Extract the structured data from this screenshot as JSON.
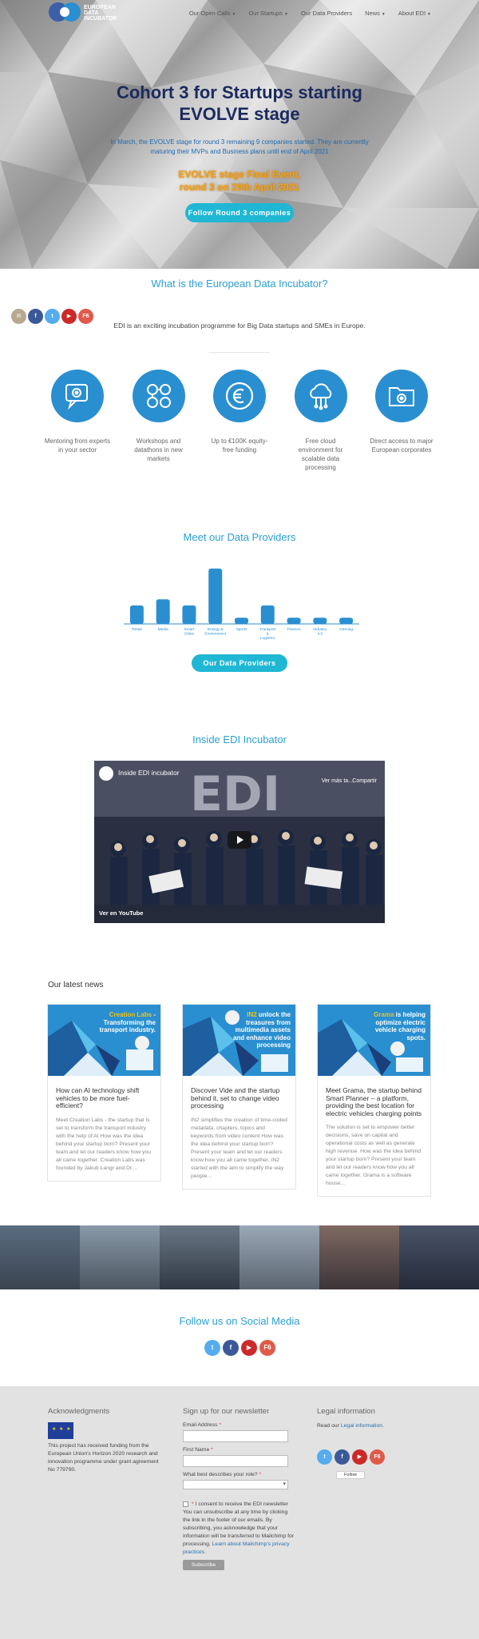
{
  "header": {
    "logo_text_line1": "EUROPEAN",
    "logo_text_line2": "DATA",
    "logo_text_line3": "INCUBATOR",
    "menu": [
      {
        "label": "Our Open Calls",
        "dropdown": true
      },
      {
        "label": "Our Startups",
        "dropdown": true
      },
      {
        "label": "Our Data Providers",
        "dropdown": false
      },
      {
        "label": "News",
        "dropdown": true
      },
      {
        "label": "About EDI",
        "dropdown": true
      }
    ]
  },
  "hero": {
    "title_line1": "Cohort 3 for Startups starting",
    "title_line2": "EVOLVE stage",
    "subtitle": "In March, the EVOLVE stage for round 3 remaining 9 companies started. They are currently maturing their MVPs and Business plans until end of April 2021",
    "event_line1": "EVOLVE stage Final Event,",
    "event_line2": "round 3 on 29th April 2021",
    "button_label": "Follow Round 3 companies"
  },
  "about": {
    "title": "What is the European Data Incubator?",
    "intro": "EDI is an exciting incubation programme for Big Data startups and SMEs in Europe.",
    "share_icons": [
      "email-icon",
      "facebook-icon",
      "twitter-icon",
      "youtube-icon",
      "f6s-icon"
    ],
    "features": [
      {
        "icon": "gear-chat-icon",
        "label": "Mentoring from experts in your sector"
      },
      {
        "icon": "team-network-icon",
        "label": "Workshops and datathons in new markets"
      },
      {
        "icon": "euro-icon",
        "label": "Up to €100K equity-free funding"
      },
      {
        "icon": "cloud-icon",
        "label": "Free cloud environment for scalable data processing"
      },
      {
        "icon": "folder-gear-icon",
        "label": "Direct access to major European corporates"
      }
    ]
  },
  "providers": {
    "title": "Meet our Data Providers",
    "button_label": "Our Data Providers"
  },
  "chart_data": {
    "type": "bar",
    "title": "",
    "xlabel": "",
    "ylabel": "",
    "categories": [
      "Retail",
      "Media",
      "Smart Cities",
      "Energy & Environment",
      "Sports",
      "Transport & Logistics",
      "Finance",
      "Industry 4.0",
      "Gaming"
    ],
    "values": [
      3,
      4,
      3,
      9,
      1,
      3,
      1,
      1,
      1
    ],
    "ylim": [
      0,
      10
    ],
    "color": "#2a8fd0"
  },
  "video": {
    "section_title": "Inside EDI Incubator",
    "title": "Inside EDI incubator",
    "watch_later": "Ver más ta...",
    "share": "Compartir",
    "watch_on": "Ver en",
    "platform": "YouTube"
  },
  "news": {
    "heading": "Our latest news",
    "cards": [
      {
        "image_text_a": "Creation Labs",
        "image_text_b": "- Transforming the transport industry.",
        "title": "How can AI technology shift vehicles to be more fuel-efficient?",
        "body": "Meet Creation Labs - the startup that is set to transform the transport industry with the help of AI How was the idea behind your startup born? Present your team and let our readers know how you all came together. Creation Labs was founded by Jakub Langr and Dr...."
      },
      {
        "image_text_a": "IN2",
        "image_text_b": "unlock the treasures from multimedia assets and enhance video processing",
        "title": "Discover Vide and the startup behind it, set to change video processing",
        "body": "IN2 simplifies the creation of time-coded metadata, chapters, topics and keywords from video content How was the idea behind your startup born? Present your team and let our readers know how you all came together. IN2 started with the aim to simplify the way people..."
      },
      {
        "image_text_a": "Grama",
        "image_text_b": "is helping optimize electric vehicle charging spots.",
        "title": "Meet Grama, the startup behind Smart Planner – a platform, providing the best location for electric vehicles charging points",
        "body": "The solution is set to empower better decisions, save on capital and operational costs as well as generate high revenue. How was the idea behind your startup born? Present your team and let our readers know how you all came together. Grama is a software house..."
      }
    ]
  },
  "social": {
    "title": "Follow us on Social Media",
    "icons": [
      "twitter-icon",
      "facebook-icon",
      "youtube-icon",
      "f6s-icon"
    ]
  },
  "footer": {
    "ack_title": "Acknowledgments",
    "ack_text": "This project has received funding from the European Union's Horizon 2020 research and innovation programme under grant agreement No 779790.",
    "newsletter_title": "Sign up for our newsletter",
    "email_label": "Email Address",
    "first_name_label": "First Name",
    "role_label": "What best describes your role?",
    "required_mark": "*",
    "consent_label": "I consent to receive the EDI newsletter",
    "consent_text": "You can unsubscribe at any time by clicking the link in the footer of our emails. By subscribing, you acknowledge that your information will be transferred to Mailchimp for processing.",
    "privacy_link": "Learn about Mailchimp's privacy practices.",
    "subscribe_label": "Subscribe",
    "legal_title": "Legal information",
    "legal_text": "Read our",
    "legal_link": "Legal information.",
    "follow_label": "Follow"
  },
  "colors": {
    "accent": "#1fb7d4",
    "title_blue": "#2a9fd6",
    "icon_blue": "#2a8fd0",
    "hero_title": "#1b2a5e",
    "event_orange": "#f4a21a"
  }
}
